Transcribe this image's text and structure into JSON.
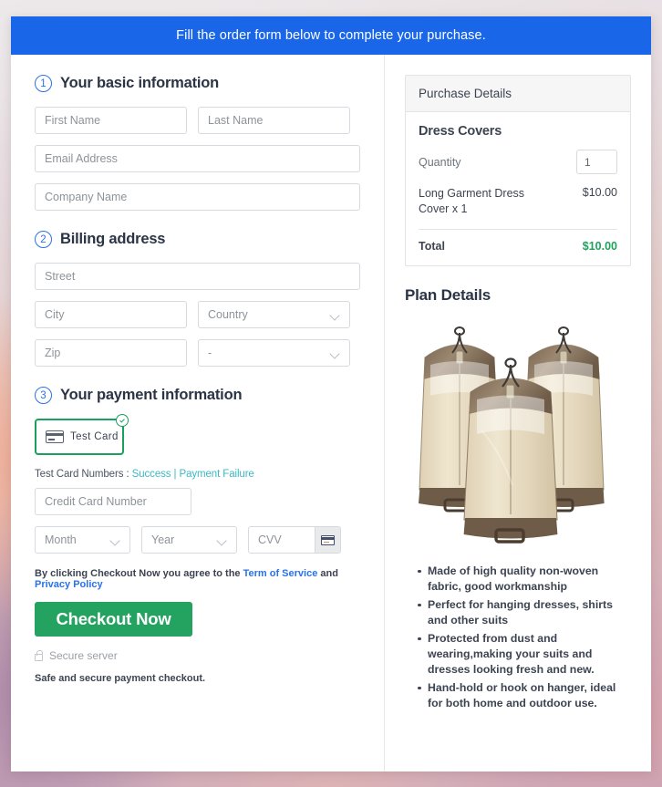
{
  "banner": {
    "text": "Fill the order form below to complete your purchase."
  },
  "steps": {
    "basic": {
      "num": "1",
      "title": "Your basic information"
    },
    "billing": {
      "num": "2",
      "title": "Billing address"
    },
    "payment": {
      "num": "3",
      "title": "Your payment information"
    }
  },
  "fields": {
    "first_name": "First Name",
    "last_name": "Last Name",
    "email": "Email Address",
    "company": "Company Name",
    "street": "Street",
    "city": "City",
    "country": "Country",
    "zip": "Zip",
    "state": "-",
    "credit_card": "Credit Card Number",
    "month": "Month",
    "year": "Year",
    "cvv": "CVV"
  },
  "payment": {
    "test_card_label": "Test Card",
    "test_numbers_prefix": "Test Card Numbers : ",
    "link_success": "Success",
    "link_separator": " | ",
    "link_failure": "Payment Failure"
  },
  "legal": {
    "agree_prefix": "By clicking Checkout Now you agree to the ",
    "terms_link": "Term of Service",
    "agree_middle": " and ",
    "privacy_link": "Privacy Policy",
    "checkout_button": "Checkout Now",
    "secure_server": "Secure server",
    "safe_note": "Safe and secure payment checkout."
  },
  "purchase": {
    "header": "Purchase Details",
    "product_title": "Dress Covers",
    "quantity_label": "Quantity",
    "quantity_value": "1",
    "line_item_name": "Long Garment Dress Cover x 1",
    "line_item_price": "$10.00",
    "total_label": "Total",
    "total_value": "$10.00"
  },
  "plan": {
    "title": "Plan Details",
    "features": [
      "Made of high quality non-woven fabric, good workmanship",
      "Perfect for hanging dresses, shirts and other suits",
      "Protected from dust and wearing,making your suits and dresses looking fresh and new.",
      "Hand-hold or hook on hanger, ideal for both home and outdoor use."
    ]
  },
  "colors": {
    "banner_blue": "#1a66e8",
    "checkout_green": "#23a35f",
    "total_green": "#1fa35c",
    "link_teal": "#3cb8c4",
    "link_blue": "#2a72e8",
    "step_blue": "#2a72e8"
  }
}
